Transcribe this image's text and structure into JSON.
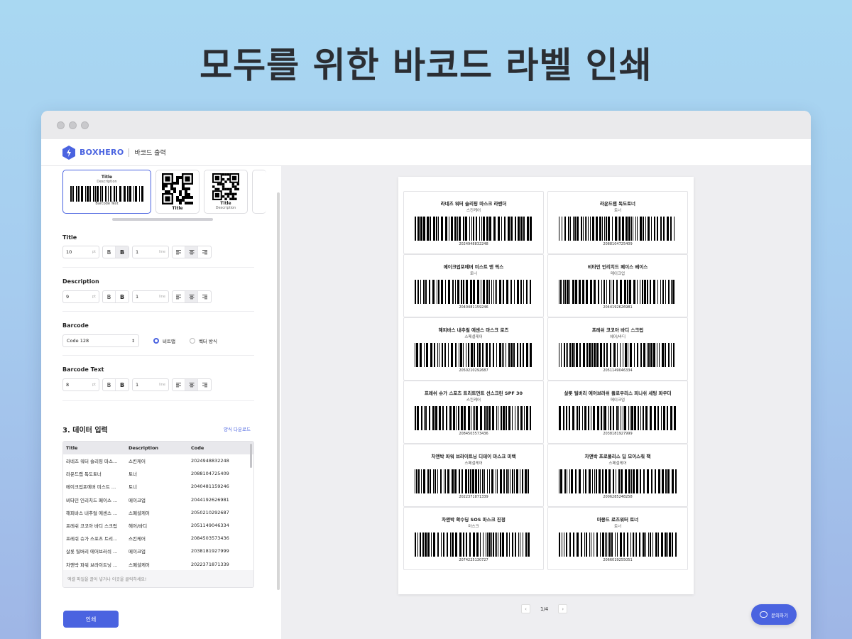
{
  "hero": {
    "title": "모두를 위한 바코드 라벨 인쇄"
  },
  "app": {
    "logo_text": "BOXHERO",
    "page_name": "바코드 출력"
  },
  "templates": [
    {
      "title": "Title",
      "description": "Description",
      "barcode_text": "Barcode Text",
      "kind": "barcode",
      "selected": true
    },
    {
      "title": "Title",
      "description": "",
      "kind": "qr"
    },
    {
      "title": "Title",
      "description": "Description",
      "kind": "qr"
    }
  ],
  "settings": {
    "title": {
      "label": "Title",
      "font_size": "10",
      "font_unit": "pt",
      "lines": "1",
      "lines_unit": "line"
    },
    "description": {
      "label": "Description",
      "font_size": "9",
      "font_unit": "pt",
      "lines": "1",
      "lines_unit": "line"
    },
    "barcode": {
      "label": "Barcode",
      "type": "Code 128",
      "options": [
        "비트맵",
        "벡터 방식"
      ],
      "selected": "비트맵"
    },
    "barcode_text": {
      "label": "Barcode Text",
      "font_size": "8",
      "font_unit": "pt",
      "lines": "1",
      "lines_unit": "line"
    },
    "bold_glyph": "B"
  },
  "data_input": {
    "heading": "3. 데이터 입력",
    "template_link": "양식 다운로드",
    "columns": [
      "Title",
      "Description",
      "Code"
    ],
    "rows": [
      [
        "라네즈 워터 슬리핑 마스...",
        "스킨케어",
        "2024948832248"
      ],
      [
        "라운드랩 독도토너",
        "토너",
        "2088104725409"
      ],
      [
        "메이크업포에버 미스트 ...",
        "토너",
        "2040481159246"
      ],
      [
        "비타민 인리치드 페이스 ...",
        "메이크업",
        "2044192626981"
      ],
      [
        "해피바스 내추럴 에센스 ...",
        "스페셜케어",
        "2050210292687"
      ],
      [
        "프레쉬 코코아 바디 스크럽",
        "헤어/바디",
        "2051149046334"
      ],
      [
        "프레쉬 슈가 스포츠 트리...",
        "스킨케어",
        "2084503573436"
      ],
      [
        "살롯 틸버리 에어브러쉬 ...",
        "메이크업",
        "2038181927999"
      ],
      [
        "차앤박 파워 브라이트닝 ...",
        "스페셜케어",
        "2022371871339"
      ]
    ],
    "drop_hint": "엑셀 파일을 끌어 넣거나 이곳을 클릭하세요!"
  },
  "print_button": "인쇄",
  "labels": [
    {
      "title": "라네즈 워터 슬리핑 마스크 라벤더",
      "description": "스킨케어",
      "code": "2024948832248"
    },
    {
      "title": "라운드랩 독도토너",
      "description": "토너",
      "code": "2088104725409"
    },
    {
      "title": "메이크업포에버 미스트 앤 픽스",
      "description": "토너",
      "code": "2040481159246"
    },
    {
      "title": "비타민 인리치드 페이스 베이스",
      "description": "메이크업",
      "code": "2044192626981"
    },
    {
      "title": "해피바스 내추럴 에센스 마스크 로즈",
      "description": "스페셜케어",
      "code": "2050210292687"
    },
    {
      "title": "프레쉬 코코아 바디 스크럽",
      "description": "헤어/바디",
      "code": "2051149046334"
    },
    {
      "title": "프레쉬 슈가 스포츠 트리트먼트 선스크린 SPF 30",
      "description": "스킨케어",
      "code": "2084503573436"
    },
    {
      "title": "살롯 틸버리 에어브러쉬 플로우리스 피니쉬 세팅 파우더",
      "description": "메이크업",
      "code": "2038181927999"
    },
    {
      "title": "차앤박 파워 브라이트닝 디데이 마스크 미백",
      "description": "스페셜케어",
      "code": "2022371871339"
    },
    {
      "title": "차앤박 프로폴리스 딥 모이스춰 팩",
      "description": "스페셜케어",
      "code": "2006285248258"
    },
    {
      "title": "차앤박 확수딩 SOS 마스크 진정",
      "description": "마스크",
      "code": "2074225130727"
    },
    {
      "title": "마몽드 로즈워터 토너",
      "description": "토너",
      "code": "2066019255051"
    }
  ],
  "pager": {
    "text": "1/4",
    "prev": "‹",
    "next": "›"
  },
  "help_button": "문의하기",
  "colors": {
    "accent": "#4a63e0"
  }
}
